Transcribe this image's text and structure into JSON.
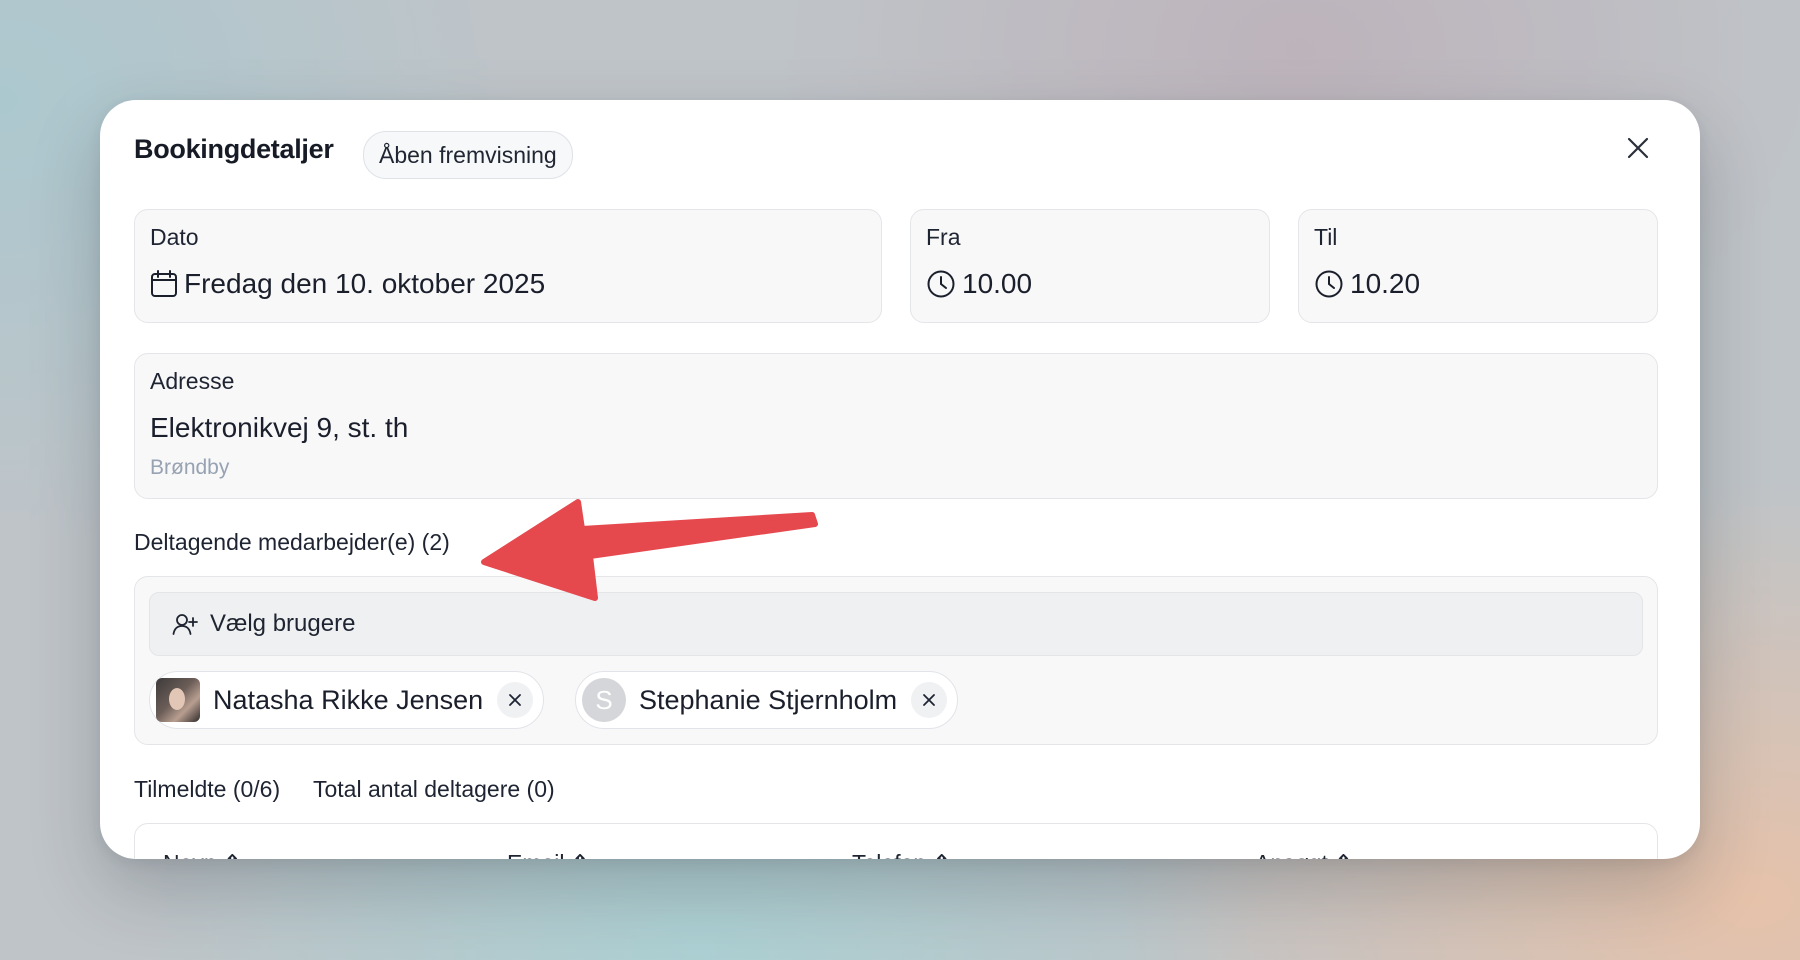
{
  "modal": {
    "title": "Bookingdetaljer",
    "badge": "Åben fremvisning",
    "close_icon": "close-icon"
  },
  "date": {
    "label": "Dato",
    "value": "Fredag den 10. oktober 2025",
    "icon": "calendar-icon"
  },
  "from": {
    "label": "Fra",
    "value": "10.00",
    "icon": "clock-icon"
  },
  "to": {
    "label": "Til",
    "value": "10.20",
    "icon": "clock-icon"
  },
  "address": {
    "label": "Adresse",
    "street": "Elektronikvej 9, st. th",
    "city": "Brøndby"
  },
  "employees": {
    "label": "Deltagende medarbejder(e) (2)",
    "select_label": "Vælg brugere",
    "select_icon": "user-plus-icon",
    "chips": [
      {
        "name": "Natasha Rikke Jensen",
        "avatar": "photo"
      },
      {
        "name": "Stephanie Stjernholm",
        "avatar_letter": "S"
      }
    ]
  },
  "signups": {
    "registered_label": "Tilmeldte (0/6)",
    "total_label": "Total antal deltagere (0)",
    "columns": [
      "Navn",
      "Email",
      "Telefon",
      "Ansøgt"
    ]
  },
  "colors": {
    "arrow": "#e5484d",
    "card_bg": "#f8f8f9",
    "muted_text": "#97a2b2"
  }
}
